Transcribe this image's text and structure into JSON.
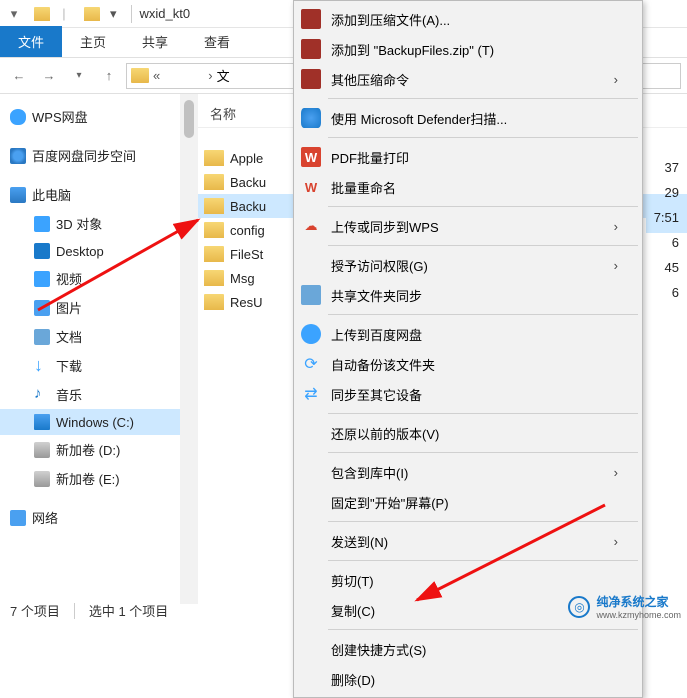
{
  "window": {
    "title": "wxid_kt0"
  },
  "ribbon": {
    "file": "文件",
    "home": "主页",
    "share": "共享",
    "view": "查看"
  },
  "addr": {
    "folder": "文"
  },
  "nav": {
    "wps": "WPS网盘",
    "baidu": "百度网盘同步空间",
    "thispc": "此电脑",
    "objects3d": "3D 对象",
    "desktop": "Desktop",
    "video": "视频",
    "pictures": "图片",
    "docs": "文档",
    "downloads": "下载",
    "music": "音乐",
    "windows": "Windows (C:)",
    "volD": "新加卷 (D:)",
    "volE": "新加卷 (E:)",
    "network": "网络"
  },
  "content": {
    "col_name": "名称",
    "rows": {
      "r0": "Apple",
      "r1": "Backu",
      "r2": "Backu",
      "r3": "config",
      "r4": "FileSt",
      "r5": "Msg",
      "r6": "ResU"
    },
    "times": {
      "t0": "37",
      "t1": "29",
      "t2": "7:51",
      "t3": "6",
      "t4": "45",
      "t5": "6"
    }
  },
  "ctx": {
    "c0": "添加到压缩文件(A)...",
    "c1": "添加到 \"BackupFiles.zip\" (T)",
    "c2": "其他压缩命令",
    "c3": "使用 Microsoft Defender扫描...",
    "c4": "PDF批量打印",
    "c5": "批量重命名",
    "c6": "上传或同步到WPS",
    "c7": "授予访问权限(G)",
    "c8": "共享文件夹同步",
    "c9": "上传到百度网盘",
    "c10": "自动备份该文件夹",
    "c11": "同步至其它设备",
    "c12": "还原以前的版本(V)",
    "c13": "包含到库中(I)",
    "c14": "固定到\"开始\"屏幕(P)",
    "c15": "发送到(N)",
    "c16": "剪切(T)",
    "c17": "复制(C)",
    "c18": "创建快捷方式(S)",
    "c19": "删除(D)"
  },
  "status": {
    "count": "7 个项目",
    "selection": "选中 1 个项目"
  },
  "watermark": {
    "text": "纯净系统之家",
    "url": "www.kzmyhome.com"
  }
}
